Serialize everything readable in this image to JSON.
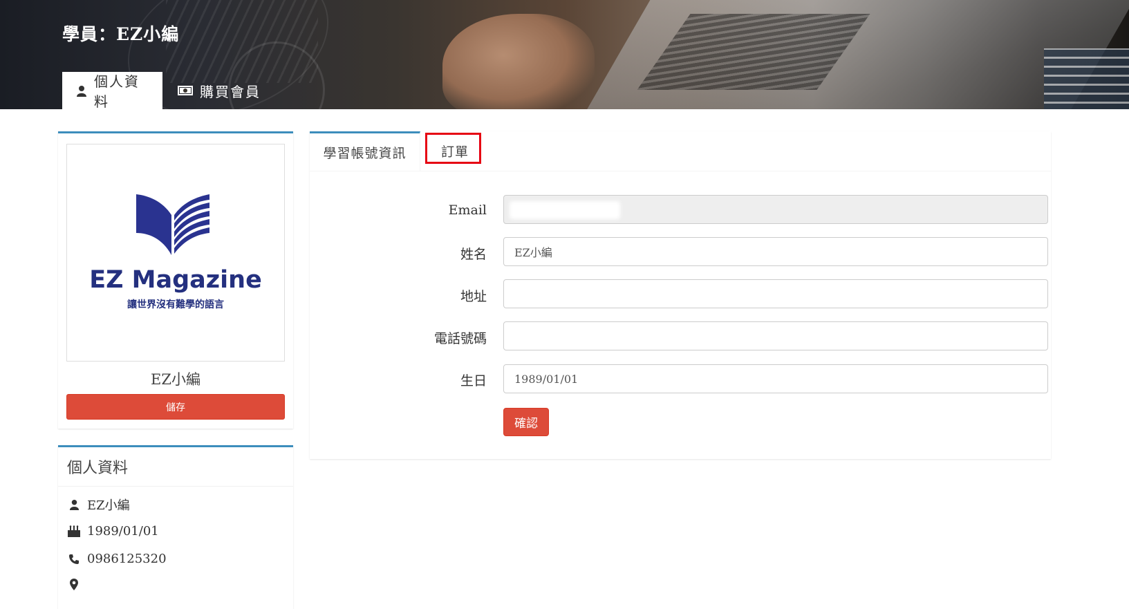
{
  "header": {
    "title": "學員：EZ小編",
    "tabs": [
      {
        "label": "個人資料",
        "icon": "user-icon",
        "active": true
      },
      {
        "label": "購買會員",
        "icon": "money-bill-icon",
        "active": false
      }
    ]
  },
  "profile": {
    "logo_text": "EZ Magazine",
    "logo_slogan": "讓世界沒有難學的語言",
    "name": "EZ小編",
    "save_label": "儲存"
  },
  "info": {
    "title": "個人資料",
    "name": "EZ小編",
    "birthday": "1989/01/01",
    "phone": "0986125320",
    "address": ""
  },
  "panel": {
    "tabs": [
      {
        "label": "學習帳號資訊",
        "active": true
      },
      {
        "label": "訂單",
        "active": false,
        "highlighted": true
      }
    ],
    "form": {
      "email_label": "Email",
      "email_value": "",
      "name_label": "姓名",
      "name_value": "EZ小編",
      "address_label": "地址",
      "address_value": "",
      "phone_label": "電話號碼",
      "phone_value": "",
      "birthday_label": "生日",
      "birthday_value": "1989/01/01",
      "confirm_label": "確認"
    }
  },
  "colors": {
    "primary_blue": "#3c8dbc",
    "danger_red": "#dd4b39",
    "highlight_red": "#e60012",
    "logo_navy": "#24307f"
  }
}
